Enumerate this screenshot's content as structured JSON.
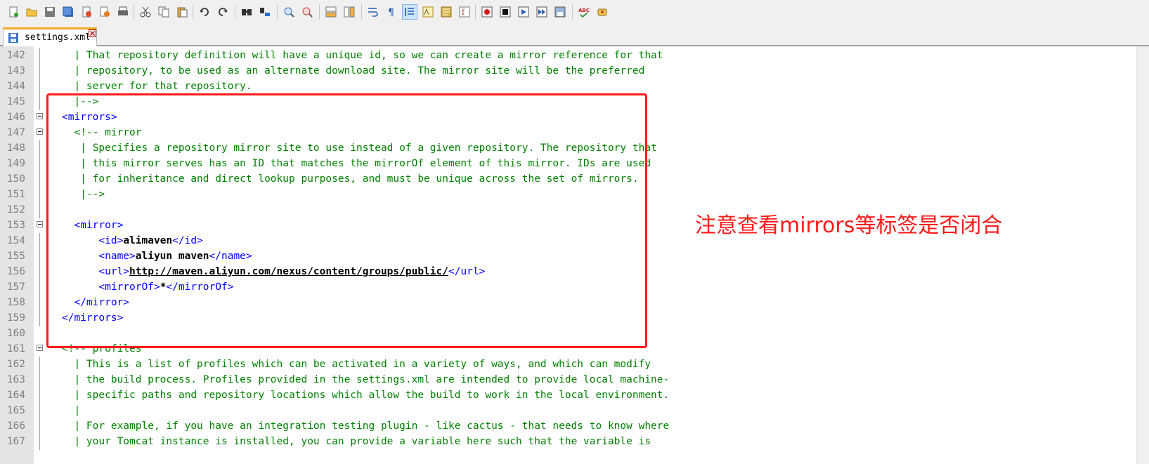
{
  "toolbar": {
    "buttons": [
      {
        "icon": "new-file-icon"
      },
      {
        "icon": "open-file-icon"
      },
      {
        "icon": "save-icon"
      },
      {
        "icon": "save-all-icon"
      },
      {
        "icon": "close-icon"
      },
      {
        "icon": "close-all-icon"
      },
      {
        "icon": "print-icon"
      },
      {
        "icon": "cut-icon"
      },
      {
        "icon": "copy-icon"
      },
      {
        "icon": "paste-icon"
      },
      {
        "icon": "undo-icon"
      },
      {
        "icon": "redo-icon"
      },
      {
        "icon": "find-icon"
      },
      {
        "icon": "replace-icon"
      },
      {
        "icon": "zoom-in-icon"
      },
      {
        "icon": "zoom-out-icon"
      },
      {
        "icon": "sync-vertical-icon"
      },
      {
        "icon": "sync-horizontal-icon"
      },
      {
        "icon": "word-wrap-icon"
      },
      {
        "icon": "show-all-characters-icon"
      },
      {
        "icon": "indent-guide-icon",
        "active": true
      },
      {
        "icon": "language-icon"
      },
      {
        "icon": "document-map-icon"
      },
      {
        "icon": "function-list-icon"
      },
      {
        "icon": "record-macro-icon"
      },
      {
        "icon": "stop-recording-icon"
      },
      {
        "icon": "play-macro-icon"
      },
      {
        "icon": "run-macro-multiple-icon"
      },
      {
        "icon": "save-macro-icon"
      },
      {
        "icon": "spell-check-icon"
      },
      {
        "icon": "plugin-icon"
      }
    ]
  },
  "tab": {
    "label": "settings.xml",
    "icon": "saved-file-icon"
  },
  "editor": {
    "lines": [
      {
        "n": "142",
        "fold": "line",
        "parts": [
          {
            "t": "  | That repository definition will have a unique id, so we can create a mirror reference for that",
            "c": "cm"
          }
        ]
      },
      {
        "n": "143",
        "fold": "line",
        "parts": [
          {
            "t": "  | repository, to be used as an alternate download site. The mirror site will be the preferred",
            "c": "cm"
          }
        ]
      },
      {
        "n": "144",
        "fold": "line",
        "parts": [
          {
            "t": "  | server for that repository.",
            "c": "cm"
          }
        ]
      },
      {
        "n": "145",
        "fold": "line",
        "parts": [
          {
            "t": "  |-->",
            "c": "cm"
          }
        ]
      },
      {
        "n": "146",
        "fold": "box",
        "parts": [
          {
            "t": "<mirrors>",
            "c": "tg"
          }
        ]
      },
      {
        "n": "147",
        "fold": "box",
        "parts": [
          {
            "t": "  <!-- mirror",
            "c": "cm"
          }
        ]
      },
      {
        "n": "148",
        "fold": "line",
        "parts": [
          {
            "t": "   | Specifies a repository mirror site to use instead of a given repository. The repository that",
            "c": "cm"
          }
        ]
      },
      {
        "n": "149",
        "fold": "line",
        "parts": [
          {
            "t": "   | this mirror serves has an ID that matches the mirrorOf element of this mirror. IDs are used",
            "c": "cm"
          }
        ]
      },
      {
        "n": "150",
        "fold": "line",
        "parts": [
          {
            "t": "   | for inheritance and direct lookup purposes, and must be unique across the set of mirrors.",
            "c": "cm"
          }
        ]
      },
      {
        "n": "151",
        "fold": "line",
        "parts": [
          {
            "t": "   |-->",
            "c": "cm"
          }
        ]
      },
      {
        "n": "152",
        "fold": "line",
        "parts": [
          {
            "t": "",
            "c": "cm"
          }
        ]
      },
      {
        "n": "153",
        "fold": "box",
        "parts": [
          {
            "t": "  <mirror>",
            "c": "tg"
          }
        ]
      },
      {
        "n": "154",
        "fold": "line",
        "parts": [
          {
            "t": "      <id>",
            "c": "tg"
          },
          {
            "t": "alimaven",
            "c": "tx"
          },
          {
            "t": "</id>",
            "c": "tg"
          }
        ]
      },
      {
        "n": "155",
        "fold": "line",
        "parts": [
          {
            "t": "      <name>",
            "c": "tg"
          },
          {
            "t": "aliyun maven",
            "c": "tx"
          },
          {
            "t": "</name>",
            "c": "tg"
          }
        ]
      },
      {
        "n": "156",
        "fold": "line",
        "parts": [
          {
            "t": "      <url>",
            "c": "tg"
          },
          {
            "t": "http://maven.aliyun.com/nexus/content/groups/public/",
            "c": "tx url"
          },
          {
            "t": "</url>",
            "c": "tg"
          }
        ]
      },
      {
        "n": "157",
        "fold": "line",
        "parts": [
          {
            "t": "      <mirrorOf>",
            "c": "tg"
          },
          {
            "t": "*",
            "c": "tx"
          },
          {
            "t": "</mirrorOf>",
            "c": "tg"
          }
        ]
      },
      {
        "n": "158",
        "fold": "line",
        "parts": [
          {
            "t": "  </mirror>",
            "c": "tg"
          }
        ]
      },
      {
        "n": "159",
        "fold": "line",
        "parts": [
          {
            "t": "</mirrors>",
            "c": "tg"
          }
        ]
      },
      {
        "n": "160",
        "fold": "none",
        "parts": [
          {
            "t": "",
            "c": "cm"
          }
        ]
      },
      {
        "n": "161",
        "fold": "box",
        "parts": [
          {
            "t": "<!-- profiles",
            "c": "cm"
          }
        ]
      },
      {
        "n": "162",
        "fold": "line",
        "parts": [
          {
            "t": "  | This is a list of profiles which can be activated in a variety of ways, and which can modify",
            "c": "cm"
          }
        ]
      },
      {
        "n": "163",
        "fold": "line",
        "parts": [
          {
            "t": "  | the build process. Profiles provided in the settings.xml are intended to provide local machine-",
            "c": "cm"
          }
        ]
      },
      {
        "n": "164",
        "fold": "line",
        "parts": [
          {
            "t": "  | specific paths and repository locations which allow the build to work in the local environment.",
            "c": "cm"
          }
        ]
      },
      {
        "n": "165",
        "fold": "line",
        "parts": [
          {
            "t": "  |",
            "c": "cm"
          }
        ]
      },
      {
        "n": "166",
        "fold": "line",
        "parts": [
          {
            "t": "  | For example, if you have an integration testing plugin - like cactus - that needs to know where",
            "c": "cm"
          }
        ]
      },
      {
        "n": "167",
        "fold": "line",
        "parts": [
          {
            "t": "  | your Tomcat instance is installed, you can provide a variable here such that the variable is",
            "c": "cm"
          }
        ]
      }
    ]
  },
  "annotation": {
    "text": "注意查看mirrors等标签是否闭合",
    "color": "#ff1a1a"
  }
}
